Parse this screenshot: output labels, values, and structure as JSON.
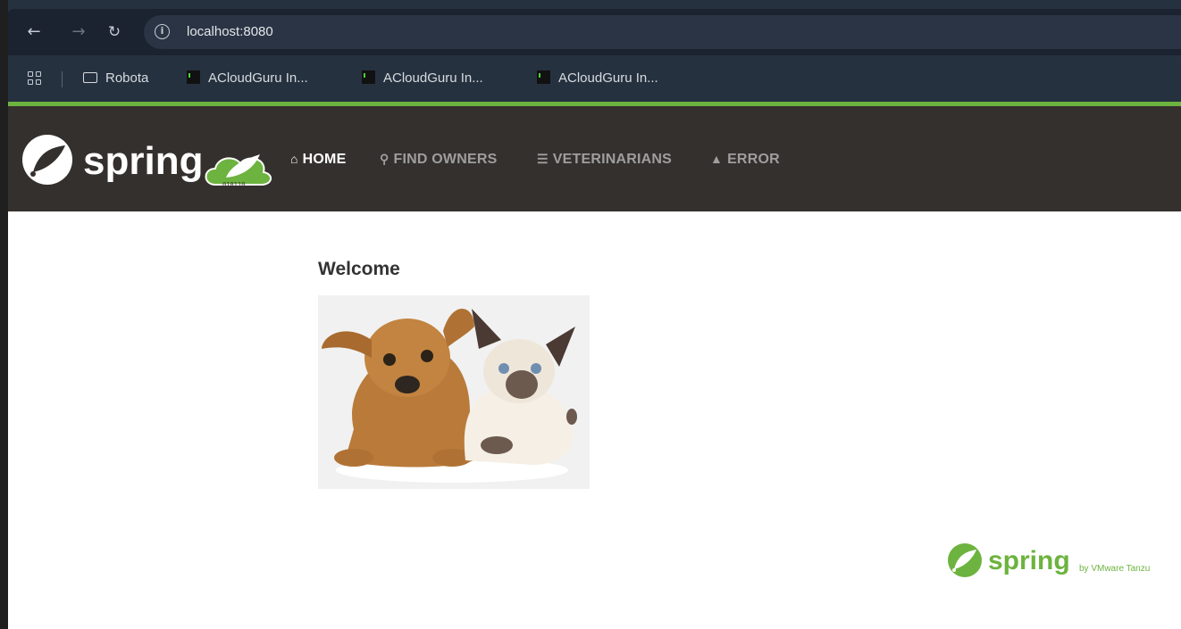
{
  "browser": {
    "url": "localhost:8080",
    "bookmarks": [
      {
        "label": "Robota",
        "icon": "folder-icon"
      },
      {
        "label": "ACloudGuru In...",
        "icon": "terminal-icon"
      },
      {
        "label": "ACloudGuru In...",
        "icon": "terminal-icon"
      },
      {
        "label": "ACloudGuru In...",
        "icon": "terminal-icon"
      }
    ]
  },
  "navbar": {
    "logo_text": "spring",
    "badge_text": "010110",
    "items": [
      {
        "label": "HOME",
        "icon": "home-icon",
        "active": true
      },
      {
        "label": "FIND OWNERS",
        "icon": "search-icon",
        "active": false
      },
      {
        "label": "VETERINARIANS",
        "icon": "list-icon",
        "active": false
      },
      {
        "label": "ERROR",
        "icon": "warning-icon",
        "active": false
      }
    ]
  },
  "main": {
    "title": "Welcome"
  },
  "footer": {
    "logo_text": "spring",
    "byline": "by VMware Tanzu"
  },
  "colors": {
    "spring_green": "#6db33f",
    "navbar_bg": "#34302d",
    "chrome_bg": "#263140"
  }
}
